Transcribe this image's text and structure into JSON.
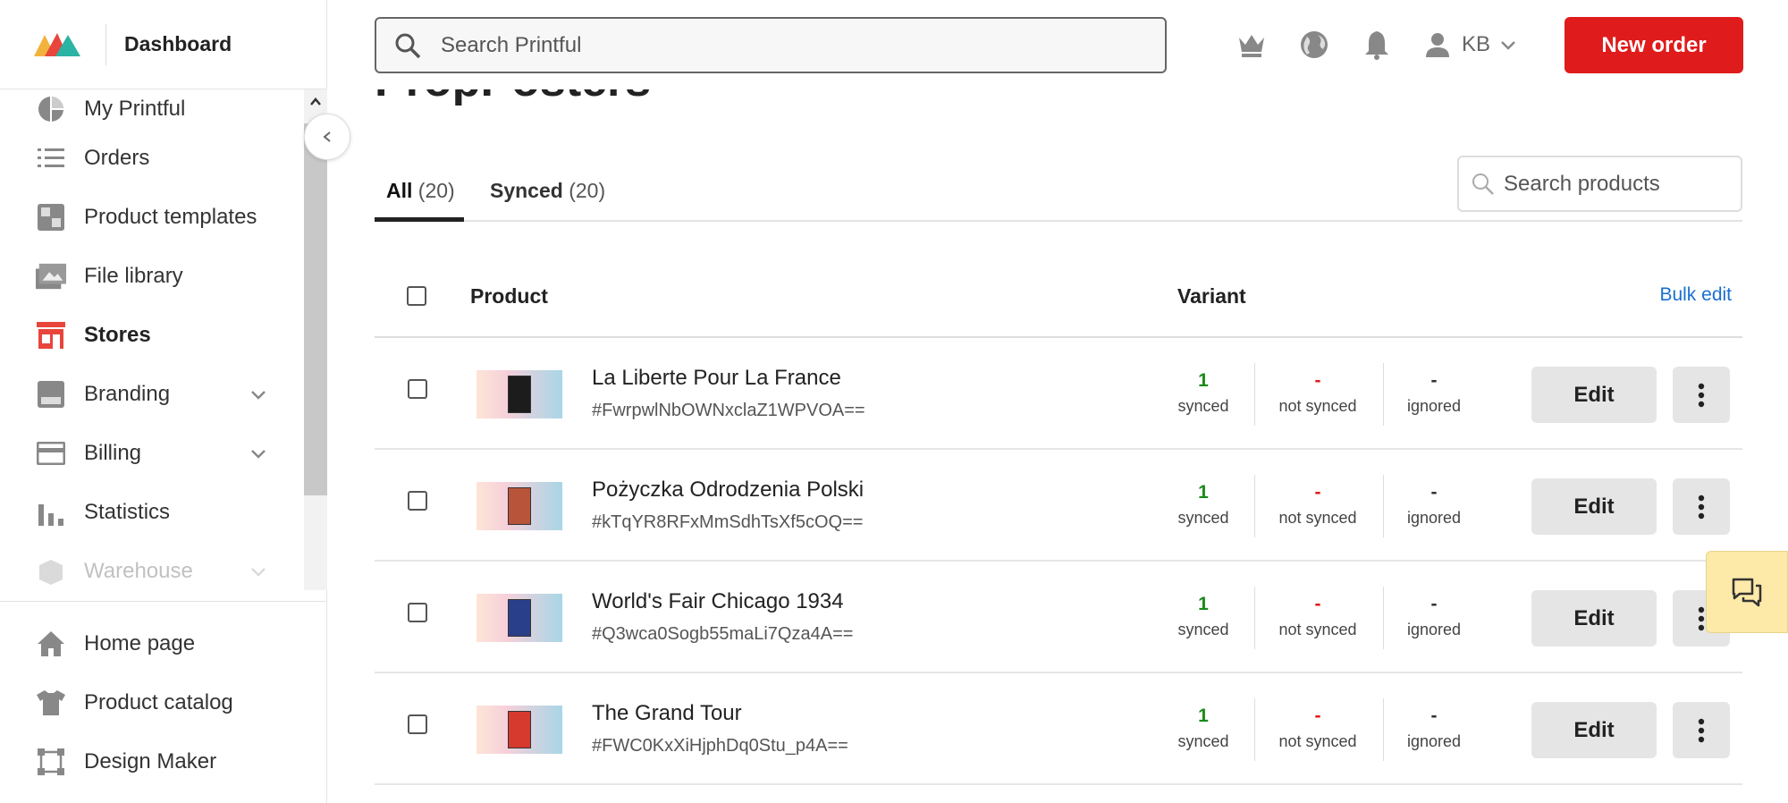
{
  "sidebar": {
    "title": "Dashboard",
    "items": [
      {
        "label": "My Printful",
        "icon": "pie-chart-icon"
      },
      {
        "label": "Orders",
        "icon": "list-icon"
      },
      {
        "label": "Product templates",
        "icon": "template-icon"
      },
      {
        "label": "File library",
        "icon": "images-icon"
      },
      {
        "label": "Stores",
        "icon": "store-icon",
        "active": true
      },
      {
        "label": "Branding",
        "icon": "branding-icon",
        "expandable": true
      },
      {
        "label": "Billing",
        "icon": "card-icon",
        "expandable": true
      },
      {
        "label": "Statistics",
        "icon": "bar-chart-icon"
      },
      {
        "label": "Warehouse",
        "icon": "box-icon",
        "expandable": true
      }
    ],
    "bottom_items": [
      {
        "label": "Home page",
        "icon": "home-icon"
      },
      {
        "label": "Product catalog",
        "icon": "tshirt-icon"
      },
      {
        "label": "Design Maker",
        "icon": "design-icon"
      }
    ]
  },
  "header": {
    "search_placeholder": "Search Printful",
    "user_initials": "KB",
    "new_order_label": "New order"
  },
  "main": {
    "title": "PropPosters",
    "tabs": [
      {
        "label": "All",
        "count": "(20)",
        "active": true
      },
      {
        "label": "Synced",
        "count": "(20)",
        "active": false
      }
    ],
    "search_placeholder": "Search products",
    "columns": {
      "product": "Product",
      "variant": "Variant",
      "bulk_edit": "Bulk edit"
    },
    "status_labels": {
      "synced": "synced",
      "not_synced": "not synced",
      "ignored": "ignored"
    },
    "edit_label": "Edit",
    "rows": [
      {
        "name": "La Liberte Pour La France",
        "id": "#FwrpwlNbOWNxclaZ1WPVOA==",
        "synced": "1",
        "not_synced": "-",
        "ignored": "-",
        "poster_color": "#1c1c1c"
      },
      {
        "name": "Pożyczka Odrodzenia Polski",
        "id": "#kTqYR8RFxMmSdhTsXf5cOQ==",
        "synced": "1",
        "not_synced": "-",
        "ignored": "-",
        "poster_color": "#b8543a"
      },
      {
        "name": "World's Fair Chicago 1934",
        "id": "#Q3wca0Sogb55maLi7Qza4A==",
        "synced": "1",
        "not_synced": "-",
        "ignored": "-",
        "poster_color": "#2a3f8a"
      },
      {
        "name": "The Grand Tour",
        "id": "#FWC0KxXiHjphDq0Stu_p4A==",
        "synced": "1",
        "not_synced": "-",
        "ignored": "-",
        "poster_color": "#d63a2e"
      }
    ]
  },
  "colors": {
    "accent": "#e01b1b",
    "synced": "#1a8a1a",
    "not_synced": "#e01b1b",
    "link": "#1a6fd1"
  }
}
